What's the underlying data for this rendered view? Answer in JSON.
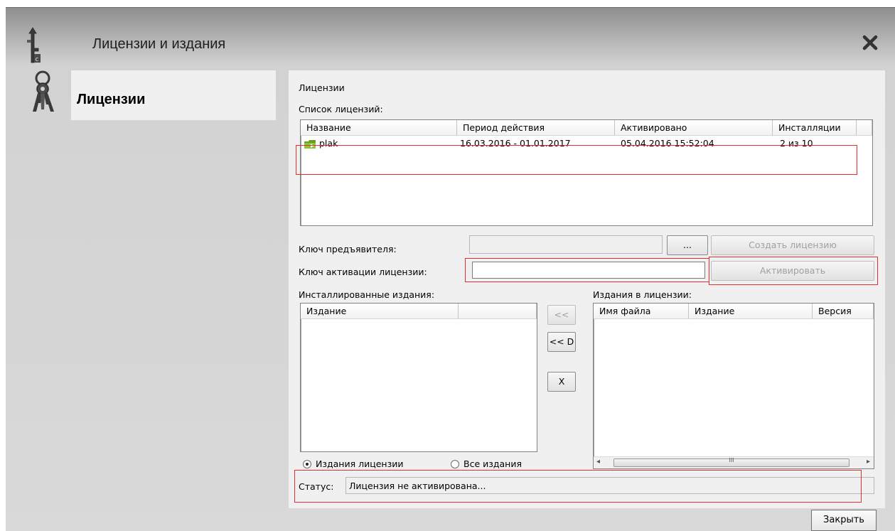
{
  "window": {
    "title": "Лицензии и издания"
  },
  "nav": {
    "items": [
      {
        "label": "Лицензии",
        "icon": "keys-icon"
      }
    ]
  },
  "panel": {
    "heading": "Лицензии",
    "license_list_label": "Список лицензий:",
    "license_table": {
      "columns": [
        "Название",
        "Период действия",
        "Активировано",
        "Инсталляции"
      ],
      "rows": [
        {
          "name": "plak",
          "period": "16.03.2016 - 01.01.2017",
          "activated": "05.04.2016 15:52:04",
          "installs": "2 из 10",
          "icon": "license-folder-icon"
        }
      ]
    },
    "bearer_key": {
      "label": "Ключ предъявителя:",
      "value": "",
      "browse_label": "...",
      "create_label": "Создать лицензию"
    },
    "activation_key": {
      "label": "Ключ активации лицензии:",
      "value": "",
      "activate_label": "Активировать"
    },
    "installed": {
      "label": "Инсталлированные издания:",
      "columns": [
        "Издание",
        ""
      ],
      "rows": []
    },
    "transfer_buttons": {
      "move_left": "<<",
      "move_left_d": "<< D",
      "delete": "X"
    },
    "licensed": {
      "label": "Издания в лицензии:",
      "columns": [
        "Имя файла",
        "Издание",
        "Версия"
      ],
      "rows": [],
      "scrollbar_grip": "III"
    },
    "filter": {
      "option_license": "Издания лицензии",
      "option_all": "Все издания",
      "selected": "license"
    },
    "status": {
      "label": "Статус:",
      "text": "Лицензия не активирована..."
    }
  },
  "footer": {
    "close_label": "Закрыть"
  },
  "colors": {
    "highlight": "#e03030",
    "title_bar": "#8e8e8e",
    "panel_bg": "#f0f0f0"
  }
}
